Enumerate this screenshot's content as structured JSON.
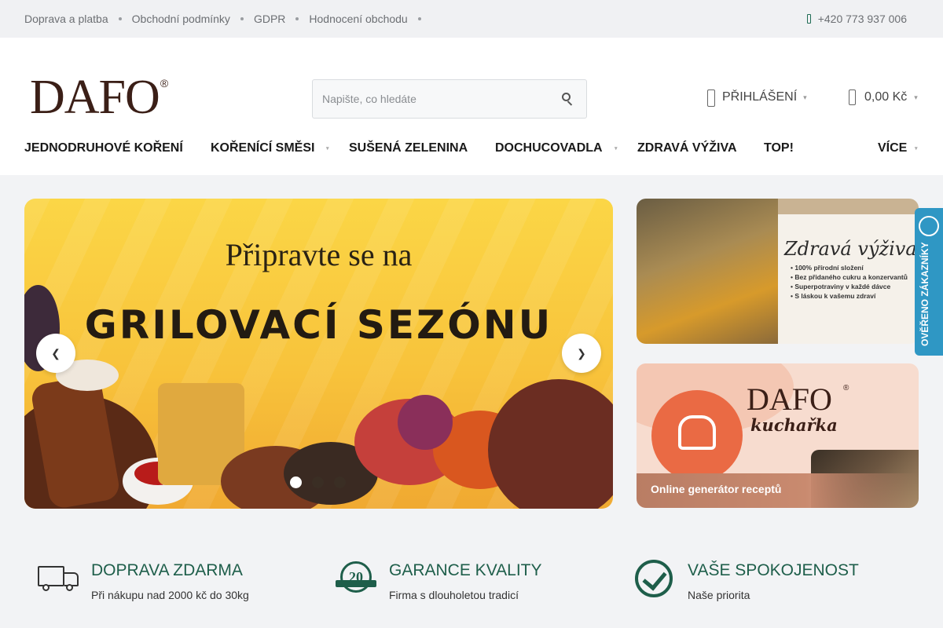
{
  "topbar": {
    "links": [
      "Doprava a platba",
      "Obchodní podmínky",
      "GDPR",
      "Hodnocení obchodu"
    ],
    "phone": "+420 773 937 006"
  },
  "header": {
    "logo": "DAFO",
    "logo_mark": "®",
    "search_placeholder": "Napište, co hledáte",
    "login": "PŘIHLÁŠENÍ",
    "cart_total": "0,00 Kč"
  },
  "nav": {
    "items": [
      "JEDNODRUHOVÉ KOŘENÍ",
      "KOŘENÍCÍ SMĚSI",
      "SUŠENÁ ZELENINA",
      "DOCHUCOVADLA",
      "ZDRAVÁ VÝŽIVA",
      "TOP!",
      "VÍCE"
    ]
  },
  "hero": {
    "line1": "Připravte se na",
    "line2": "GRILOVACÍ SEZÓNU",
    "slides": 3,
    "active_slide": 1
  },
  "banners": {
    "health": {
      "title": "Zdravá výživa",
      "points": [
        "• 100% přírodní složení",
        "• Bez přidaného cukru a konzervantů",
        "• Superpotraviny v každé dávce",
        "• S láskou k vašemu zdraví"
      ]
    },
    "cookbook": {
      "logo": "DAFO",
      "logo_mark": "®",
      "title": "kuchařka",
      "caption": "Online generátor receptů"
    }
  },
  "badge": {
    "label": "OVĚŘENO ZÁKAZNÍKY"
  },
  "features": [
    {
      "icon": "truck-icon",
      "title": "DOPRAVA ZDARMA",
      "subtitle": "Při nákupu nad 2000 kč do 30kg"
    },
    {
      "icon": "award-20-years-icon",
      "title": "GARANCE KVALITY",
      "subtitle": "Firma s dlouholetou tradicí"
    },
    {
      "icon": "checkmark-circle-icon",
      "title": "VAŠE SPOKOJENOST",
      "subtitle": "Naše priorita"
    }
  ],
  "feature_badge_number": "20"
}
